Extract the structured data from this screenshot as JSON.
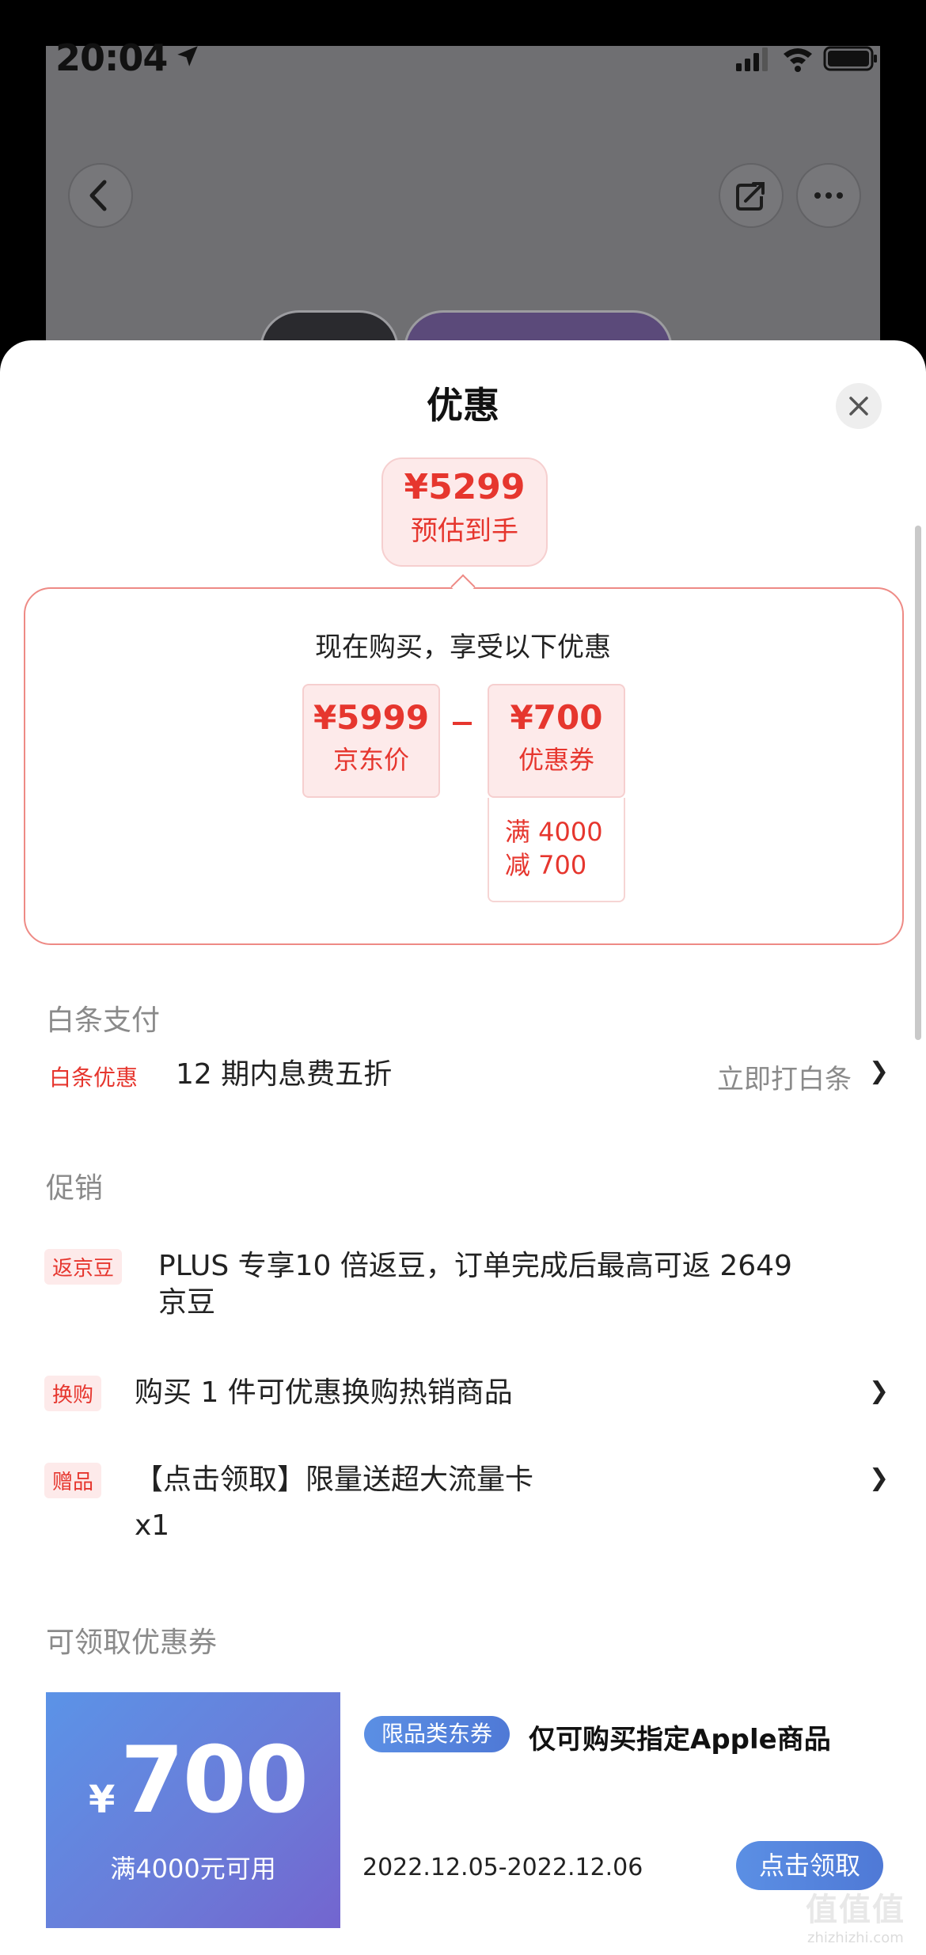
{
  "status_bar": {
    "time": "20:04"
  },
  "sheet": {
    "title": "优惠",
    "estimate": {
      "price": "¥5299",
      "label": "预估到手"
    },
    "breakdown": {
      "title": "现在购买，享受以下优惠",
      "jd_price": {
        "price": "¥5999",
        "label": "京东价"
      },
      "coupon": {
        "price": "¥700",
        "label": "优惠券",
        "cond_line1": "满 4000",
        "cond_line2": "减 700"
      }
    },
    "baitiao": {
      "heading": "白条支付",
      "tag": "白条优惠",
      "text": "12 期内息费五折",
      "action": "立即打白条",
      "chevron": "❯"
    },
    "promo": {
      "heading": "促销",
      "items": [
        {
          "tag": "返京豆",
          "text_line1": "PLUS 专享10 倍返豆，订单完成后最高可返 2649",
          "text_line2": "京豆"
        },
        {
          "tag": "换购",
          "text": "购买 1 件可优惠换购热销商品",
          "chevron": "❯"
        },
        {
          "tag": "赠品",
          "text": "【点击领取】限量送超大流量卡",
          "sub": "x1",
          "chevron": "❯"
        }
      ]
    },
    "coupons": {
      "heading": "可领取优惠券",
      "card": {
        "currency": "¥",
        "amount": "700",
        "condition": "满4000元可用",
        "badge": "限品类东券",
        "title": "仅可购买指定Apple商品",
        "date": "2022.12.05-2022.12.06",
        "button": "点击领取"
      }
    }
  },
  "watermark": {
    "main": "值值值",
    "sub": "zhizhizhi.com"
  }
}
